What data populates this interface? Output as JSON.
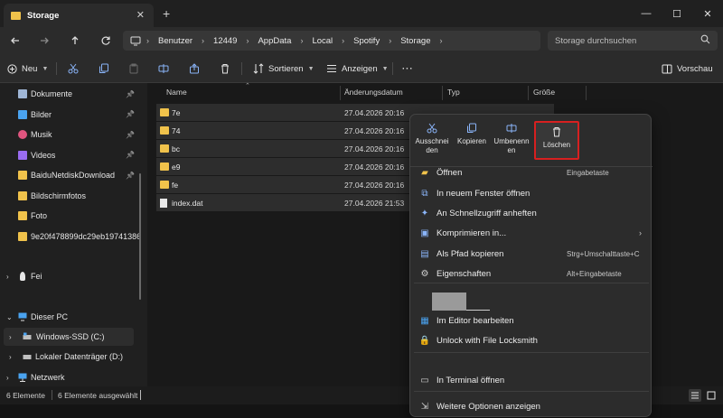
{
  "window": {
    "tab_title": "Storage",
    "new_tab_symbol": "+",
    "close_tab_symbol": "✕",
    "min_symbol": "—",
    "max_symbol": "☐",
    "close_symbol": "✕"
  },
  "address": {
    "crumbs": [
      "Benutzer",
      "12449",
      "AppData",
      "Local",
      "Spotify",
      "Storage"
    ],
    "search_placeholder": "Storage durchsuchen"
  },
  "toolbar": {
    "new_label": "Neu",
    "sort_label": "Sortieren",
    "view_label": "Anzeigen",
    "more_label": "···",
    "preview_label": "Vorschau"
  },
  "sidebar": {
    "items": [
      {
        "label": "Dokumente",
        "icon": "documents-icon",
        "pinned": true
      },
      {
        "label": "Bilder",
        "icon": "pictures-icon",
        "pinned": true
      },
      {
        "label": "Musik",
        "icon": "music-icon",
        "pinned": true
      },
      {
        "label": "Videos",
        "icon": "videos-icon",
        "pinned": true
      },
      {
        "label": "BaiduNetdiskDownload",
        "icon": "folder-icon",
        "pinned": true
      },
      {
        "label": "Bildschirmfotos",
        "icon": "folder-icon",
        "pinned": false
      },
      {
        "label": "Foto",
        "icon": "folder-icon",
        "pinned": false
      },
      {
        "label": "9e20f478899dc29eb19741386",
        "icon": "folder-icon",
        "pinned": false
      }
    ],
    "fei": "Fei",
    "this_pc": "Dieser PC",
    "drive_c": "Windows-SSD (C:)",
    "drive_d": "Lokaler Datenträger (D:)",
    "network": "Netzwerk"
  },
  "columns": {
    "name": "Name",
    "date": "Änderungsdatum",
    "type": "Typ",
    "size": "Größe"
  },
  "files": [
    {
      "name": "7e",
      "date": "27.04.2026 20:16",
      "kind": "folder"
    },
    {
      "name": "74",
      "date": "27.04.2026 20:16",
      "kind": "folder"
    },
    {
      "name": "bc",
      "date": "27.04.2026 20:16",
      "kind": "folder"
    },
    {
      "name": "e9",
      "date": "27.04.2026 20:16",
      "kind": "folder"
    },
    {
      "name": "fe",
      "date": "27.04.2026 20:16",
      "kind": "folder"
    },
    {
      "name": "index.dat",
      "date": "27.04.2026 21:53",
      "kind": "file"
    }
  ],
  "status": {
    "count": "6 Elemente",
    "selected": "6 Elemente ausgewählt"
  },
  "context_menu": {
    "quick": [
      {
        "label": "Ausschnei den",
        "icon": "cut-icon"
      },
      {
        "label": "Kopieren",
        "icon": "copy-icon"
      },
      {
        "label": "Umbenenn en",
        "icon": "rename-icon"
      },
      {
        "label": "Löschen",
        "icon": "delete-icon"
      }
    ],
    "items": [
      {
        "label": "Öffnen",
        "shortcut": "Eingabetaste",
        "icon": "folder-open-icon"
      },
      {
        "label": "In neuem Fenster öffnen",
        "shortcut": "",
        "icon": "new-window-icon"
      },
      {
        "label": "An Schnellzugriff anheften",
        "shortcut": "",
        "icon": "pin-icon"
      },
      {
        "label": "Komprimieren in...",
        "shortcut": "",
        "icon": "compress-icon"
      },
      {
        "label": "Als Pfad kopieren",
        "shortcut": "Strg+Umschalttaste+C",
        "icon": "copy-path-icon"
      },
      {
        "label": "Eigenschaften",
        "shortcut": "Alt+Eingabetaste",
        "icon": "properties-icon"
      },
      {
        "label": "Im Editor bearbeiten",
        "shortcut": "",
        "icon": "editor-icon"
      },
      {
        "label": "Unlock with File Locksmith",
        "shortcut": "",
        "icon": "lock-icon"
      },
      {
        "label": "In Terminal öffnen",
        "shortcut": "",
        "icon": "terminal-icon"
      },
      {
        "label": "Weitere Optionen anzeigen",
        "shortcut": "",
        "icon": "more-options-icon"
      }
    ]
  },
  "colors": {
    "folder": "#f0c24b",
    "highlight_border": "#d72020",
    "accent_icon": "#8ab4f8"
  }
}
